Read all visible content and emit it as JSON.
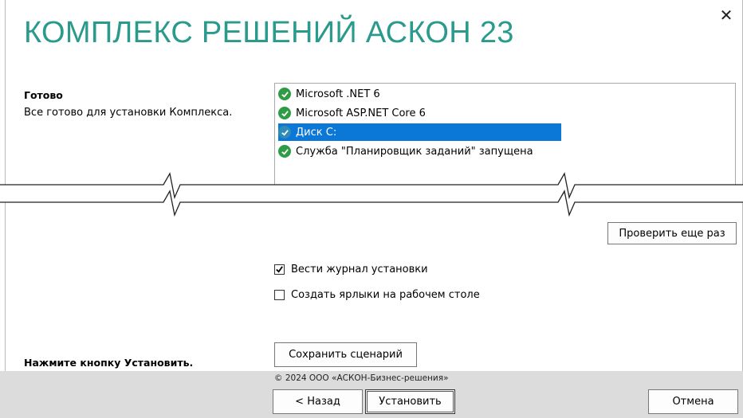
{
  "window": {
    "title": "КОМПЛЕКС РЕШЕНИЙ АСКОН 23",
    "close_label": "✕"
  },
  "status": {
    "title": "Готово",
    "description": "Все готово для установки Комплекса."
  },
  "checklist": {
    "items": [
      {
        "label": "Microsoft .NET 6",
        "state": "ok"
      },
      {
        "label": "Microsoft ASP.NET Core 6",
        "state": "ok"
      },
      {
        "label": "Диск C:",
        "state": "ok",
        "selected": true
      },
      {
        "label": "Служба \"Планировщик заданий\" запущена",
        "state": "ok"
      }
    ]
  },
  "buttons": {
    "recheck": "Проверить еще раз",
    "save_scenario": "Сохранить сценарий",
    "back": "< Назад",
    "install": "Установить",
    "cancel": "Отмена"
  },
  "options": {
    "log": {
      "label": "Вести журнал установки",
      "checked": true
    },
    "shortcuts": {
      "label": "Создать ярлыки на рабочем столе",
      "checked": false
    }
  },
  "hint": "Нажмите кнопку Установить.",
  "copyright": "© 2024 ООО «АСКОН-Бизнес-решения»",
  "colors": {
    "title": "#2a9a8c",
    "ok_icon": "#2f9b45",
    "selection": "#0b78d7",
    "footer": "#dcdcdc"
  }
}
